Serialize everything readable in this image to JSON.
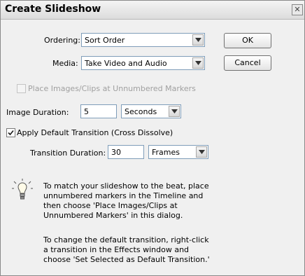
{
  "dialog": {
    "title": "Create Slideshow",
    "close_glyph": "✕"
  },
  "ordering": {
    "label": "Ordering:",
    "value": "Sort Order"
  },
  "media": {
    "label": "Media:",
    "value": "Take Video and Audio"
  },
  "buttons": {
    "ok": "OK",
    "cancel": "Cancel"
  },
  "place_images": {
    "label": "Place Images/Clips at Unnumbered Markers",
    "checked": false,
    "enabled": false
  },
  "image_duration": {
    "label": "Image Duration:",
    "value": "5",
    "unit": "Seconds"
  },
  "apply_transition": {
    "label": "Apply Default Transition (Cross Dissolve)",
    "checked": true
  },
  "transition_duration": {
    "label": "Transition Duration:",
    "value": "30",
    "unit": "Frames"
  },
  "tips": {
    "icon": "lightbulb-icon",
    "tip1": [
      "To match your slideshow to the beat, place",
      "unnumbered markers in the Timeline and",
      "then choose 'Place Images/Clips at",
      "Unnumbered Markers' in this dialog."
    ],
    "tip2": [
      "To change the default transition, right-click",
      "a transition in the Effects window and",
      "choose 'Set Selected as Default Transition.'"
    ]
  }
}
